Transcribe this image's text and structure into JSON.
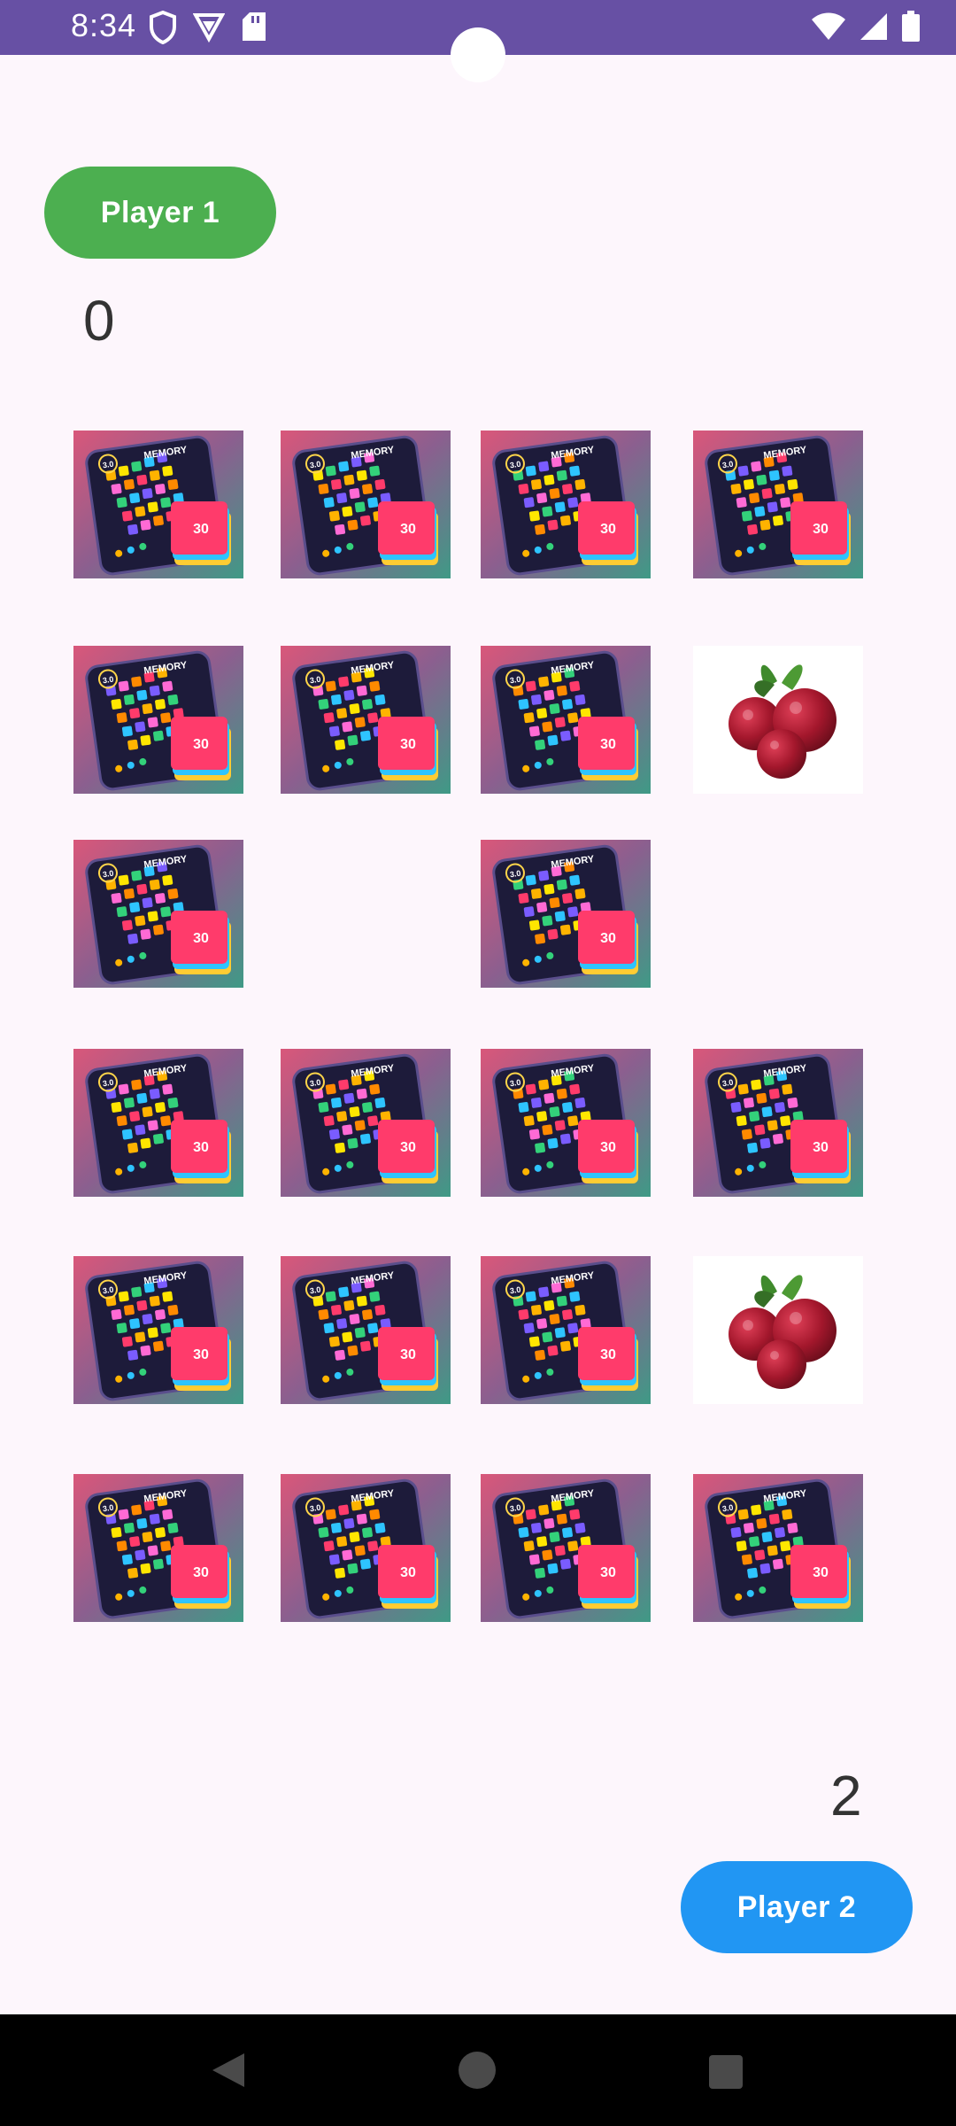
{
  "status_bar": {
    "time": "8:34",
    "icons_left": [
      "shield-icon",
      "vpn-triangle-icon",
      "sd-card-icon"
    ],
    "icons_right": [
      "wifi-icon",
      "cell-signal-icon",
      "battery-icon"
    ]
  },
  "player1": {
    "label": "Player 1",
    "score": "0",
    "color": "#4caf50"
  },
  "player2": {
    "label": "Player 2",
    "score": "2",
    "color": "#2196f3"
  },
  "board": {
    "rows": [
      [
        "back",
        "back",
        "back",
        "back"
      ],
      [
        "back",
        "back",
        "back",
        "cranberry"
      ],
      [
        "back",
        "empty",
        "back",
        "empty"
      ],
      [
        "back",
        "back",
        "back",
        "back"
      ],
      [
        "back",
        "back",
        "back",
        "cranberry"
      ],
      [
        "back",
        "back",
        "back",
        "back"
      ]
    ],
    "card_back_badge": "3.0",
    "card_back_title": "MEMORY",
    "card_back_box_label": "30"
  },
  "nav_bar": {
    "icons": [
      "back-icon",
      "home-icon",
      "recents-icon"
    ]
  }
}
